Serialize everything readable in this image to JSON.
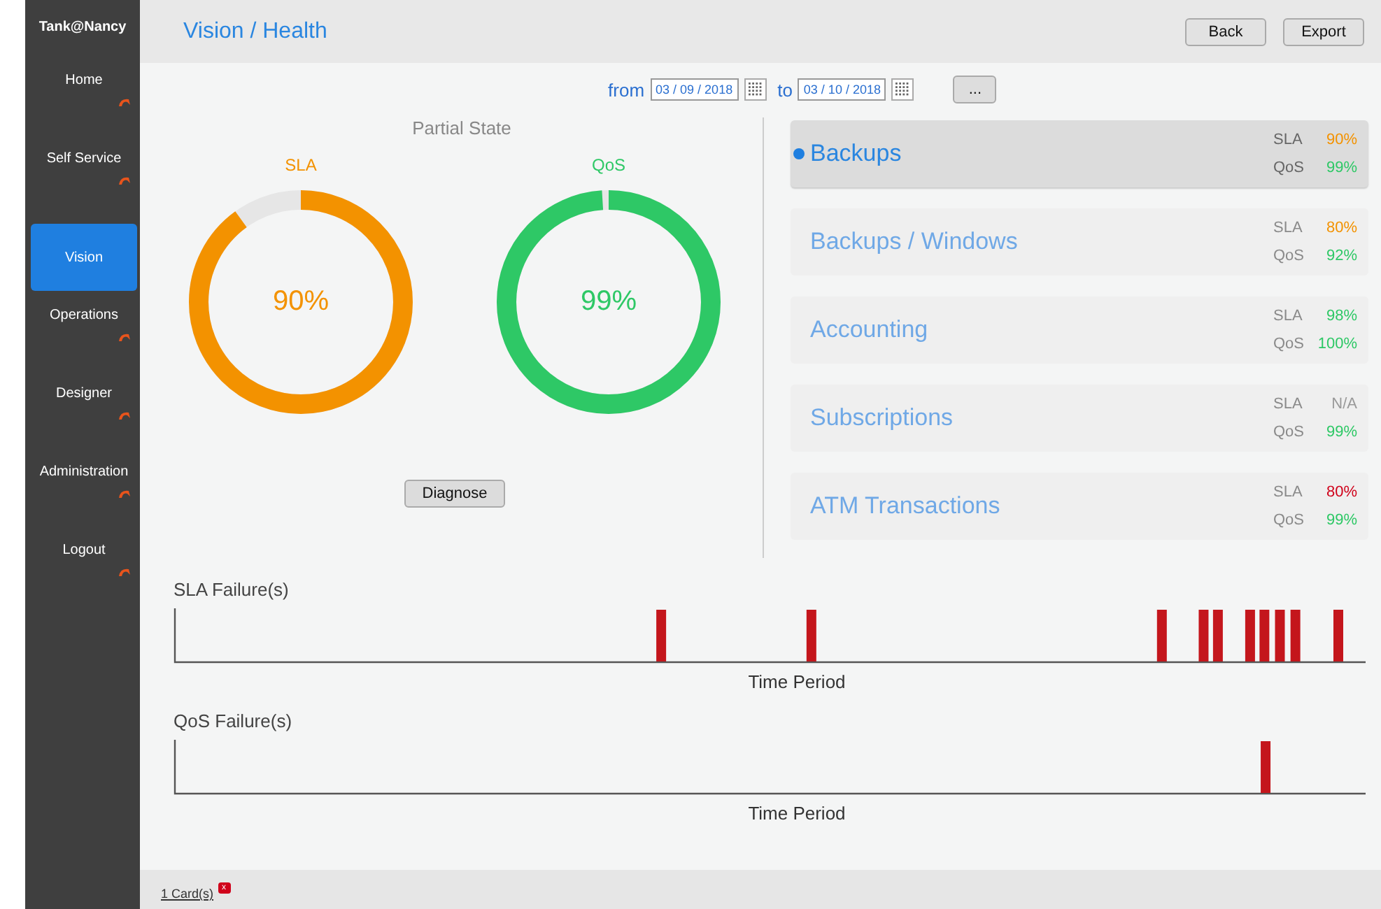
{
  "sidebar": {
    "brand": "Tank@Nancy",
    "items": [
      {
        "label": "Home",
        "selected": false
      },
      {
        "label": "Self Service",
        "selected": false
      },
      {
        "label": "Vision",
        "selected": true
      },
      {
        "label": "Operations",
        "selected": false
      },
      {
        "label": "Designer",
        "selected": false
      },
      {
        "label": "Administration",
        "selected": false
      },
      {
        "label": "Logout",
        "selected": false
      }
    ]
  },
  "header": {
    "title": "Vision / Health",
    "buttons": [
      "Back",
      "Export"
    ]
  },
  "date_range": {
    "from_label": "from",
    "from": "03 / 09 / 2018",
    "to_label": "to",
    "to": "03 / 10 / 2018",
    "more_button": "..."
  },
  "state_panel": {
    "title": "Partial State",
    "gauges": [
      {
        "label": "SLA",
        "reading": "90%",
        "level": 0.9,
        "color": "#f39200"
      },
      {
        "label": "QoS",
        "reading": "99%",
        "level": 0.99,
        "color": "#2ec866"
      }
    ],
    "button": "Diagnose"
  },
  "services": [
    {
      "name": "Backups",
      "selected": true,
      "metrics": [
        {
          "label": "SLA",
          "value": "90%",
          "color": "#f39200"
        },
        {
          "label": "QoS",
          "value": "99%",
          "color": "#2ec866"
        }
      ]
    },
    {
      "name": "Backups / Windows",
      "selected": false,
      "metrics": [
        {
          "label": "SLA",
          "value": "80%",
          "color": "#f39200"
        },
        {
          "label": "QoS",
          "value": "92%",
          "color": "#2ec866"
        }
      ]
    },
    {
      "name": "Accounting",
      "selected": false,
      "metrics": [
        {
          "label": "SLA",
          "value": "98%",
          "color": "#2ec866"
        },
        {
          "label": "QoS",
          "value": "100%",
          "color": "#2ec866"
        }
      ]
    },
    {
      "name": "Subscriptions",
      "selected": false,
      "metrics": [
        {
          "label": "SLA",
          "value": "N/A",
          "color": "#999999"
        },
        {
          "label": "QoS",
          "value": "99%",
          "color": "#2ec866"
        }
      ]
    },
    {
      "name": "ATM Transactions",
      "selected": false,
      "metrics": [
        {
          "label": "SLA",
          "value": "80%",
          "color": "#d0021b"
        },
        {
          "label": "QoS",
          "value": "99%",
          "color": "#2ec866"
        }
      ]
    }
  ],
  "failure_charts": [
    {
      "title": "SLA Failure(s)",
      "xlabel": "Time Period"
    },
    {
      "title": "QoS Failure(s)",
      "xlabel": "Time Period"
    }
  ],
  "footer": {
    "cards": "1 Card(s)",
    "badge": "x"
  }
}
